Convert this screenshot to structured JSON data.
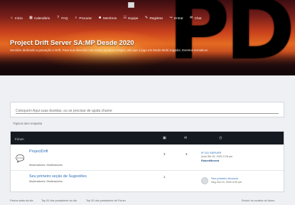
{
  "nav": {
    "items": [
      {
        "icon": "home-icon",
        "glyph": "⌂",
        "label": "Início"
      },
      {
        "icon": "calendar-icon",
        "glyph": "▦",
        "label": "Calendário"
      },
      {
        "icon": "faq-icon",
        "glyph": "?",
        "label": "FAQ"
      },
      {
        "icon": "search-icon",
        "glyph": "⌕",
        "label": "Procurar"
      },
      {
        "icon": "members-icon",
        "glyph": "☻",
        "label": "Membros"
      },
      {
        "icon": "groups-icon",
        "glyph": "☷",
        "label": "Equipe"
      },
      {
        "icon": "register-icon",
        "glyph": "✎",
        "label": "Registrar"
      },
      {
        "icon": "login-icon",
        "glyph": "↪",
        "label": "Entrar"
      },
      {
        "icon": "chat-icon",
        "glyph": "✉",
        "label": "Chat"
      }
    ]
  },
  "hero": {
    "logo_text": "PD",
    "title": "Project Drift Server SA:MP Desde 2020",
    "subtitle": "Servidor dedicado a gravação e Drift. Para sua diversão com todos os seus Amigos, até que o jogo em Modo Multi Jogador, Eventos tematicos"
  },
  "search": {
    "placeholder": "Coloquem Aqui suas duvidas, ou se precisar de ajuda chame"
  },
  "mark_read": "Tópicos sem resposta",
  "forum": {
    "header_label": "Fórum",
    "rows": [
      {
        "title": "ProjectDrift",
        "moderators": "Moderadores: Moderadores",
        "topics": "3",
        "posts": "3",
        "last_title": "IP DO SERVER",
        "last_date": "Quin Set 30, 2020 2:16 pm",
        "last_user": "RobertMovest"
      },
      {
        "title": "Seu primeiro seção de Sugestões",
        "moderators": "Moderadores: Moderadores",
        "topics": "1",
        "posts": "",
        "last_title": "Seu primeiro Anúncio",
        "last_date": "Seg Out 19, 2020 5:00 pm",
        "last_user": ""
      }
    ]
  },
  "footer": {
    "left": "Pactos atrás da dia",
    "mid1": "Top 20 dos postadores do dia",
    "mid2": "Top 20 dos postadores de Fórum",
    "right": "Excluir os cookies do fórum"
  }
}
